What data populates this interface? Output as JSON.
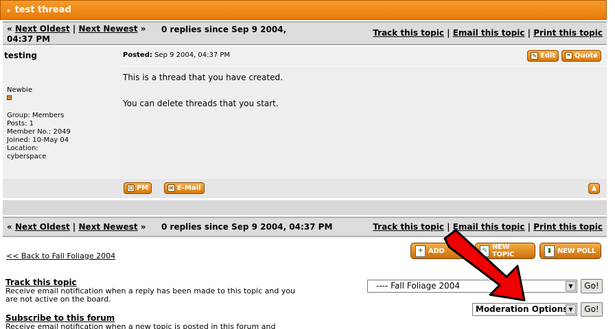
{
  "thread": {
    "title": "test thread"
  },
  "nav": {
    "prefix": "«",
    "next_oldest": "Next Oldest",
    "sep": "|",
    "next_newest": "Next Newest",
    "suffix": "»",
    "replies_line1": "0 replies since Sep 9 2004,",
    "replies_line2": "04:37 PM",
    "replies_full": "0 replies since Sep 9 2004, 04:37 PM",
    "track": "Track this topic",
    "email": "Email this topic",
    "print": "Print this topic"
  },
  "post": {
    "author": "testing",
    "posted_label": "Posted:",
    "posted_date": "Sep 9 2004, 04:37 PM",
    "edit_label": "Edit",
    "quote_label": "Quote",
    "body_line1": "This is a thread that you have created.",
    "body_line2": "You can delete threads that you start.",
    "rank": "Newbie",
    "group": "Group: Members",
    "posts": "Posts: 1",
    "member_no": "Member No.: 2049",
    "joined": "Joined: 10-May 04",
    "location_label": "Location:",
    "location_value": "cyberspace",
    "pm_label": "PM",
    "email_label": "E-Mail"
  },
  "actions": {
    "add_reply": "ADD",
    "new_topic": "NEW TOPIC",
    "new_poll": "NEW POLL"
  },
  "back_link": "<< Back to Fall Foliage 2004",
  "track_block": {
    "head": "Track this topic",
    "desc": "Receive email notification when a reply has been made to this topic and you are not active on the board."
  },
  "subscribe_block": {
    "head": "Subscribe to this forum",
    "desc": "Receive email notification when a new topic is posted in this forum and"
  },
  "forum_jump": {
    "value": "---- Fall Foliage 2004",
    "go": "Go!"
  },
  "moderation": {
    "value": "Moderation Options",
    "go": "Go!"
  },
  "colors": {
    "header_orange": "#e87b08",
    "nav_gray": "#dcdcdc",
    "annotation_red": "#ee0000"
  }
}
